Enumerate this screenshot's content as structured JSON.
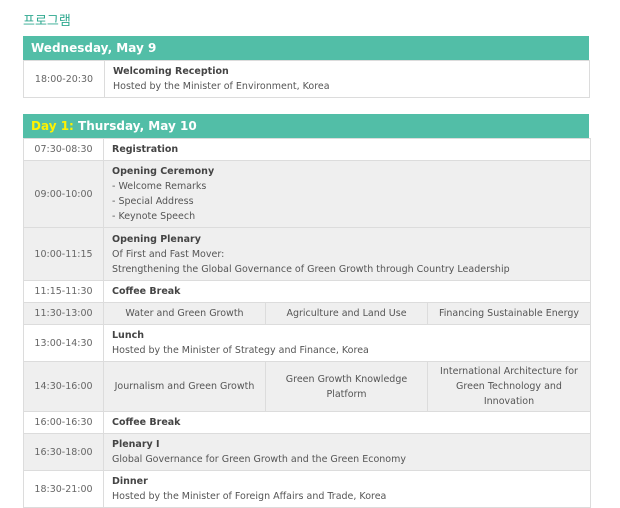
{
  "title": "프로그램",
  "pre_day": {
    "header": "Wednesday, May 9",
    "rows": [
      {
        "time": "18:00-20:30",
        "title": "Welcoming Reception",
        "lines": [
          "Hosted by the Minister of Environment, Korea"
        ]
      }
    ]
  },
  "day1": {
    "header_prefix": "Day 1:",
    "header_rest": " Thursday, May 10",
    "registration": {
      "time": "07:30-08:30",
      "title": "Registration"
    },
    "opening_ceremony": {
      "time": "09:00-10:00",
      "title": "Opening Ceremony",
      "lines": [
        "- Welcome Remarks",
        "- Special Address",
        "- Keynote Speech"
      ]
    },
    "opening_plenary": {
      "time": "10:00-11:15",
      "title": "Opening Plenary",
      "lines": [
        "Of First and Fast Mover:",
        "Strengthening the Global Governance of Green Growth through Country Leadership"
      ]
    },
    "coffee1": {
      "time": "11:15-11:30",
      "title": "Coffee Break"
    },
    "sessions1": {
      "time": "11:30-13:00",
      "tracks": [
        "Water and Green Growth",
        "Agriculture and Land Use",
        "Financing Sustainable Energy"
      ]
    },
    "lunch": {
      "time": "13:00-14:30",
      "title": "Lunch",
      "lines": [
        "Hosted by the Minister of Strategy and Finance, Korea"
      ]
    },
    "sessions2": {
      "time": "14:30-16:00",
      "tracks": [
        "Journalism and Green Growth",
        "Green Growth Knowledge Platform",
        "International Architecture for Green Technology and Innovation"
      ]
    },
    "coffee2": {
      "time": "16:00-16:30",
      "title": "Coffee Break"
    },
    "plenary1": {
      "time": "16:30-18:00",
      "title": "Plenary I",
      "lines": [
        "Global Governance for Green Growth and the Green Economy"
      ]
    },
    "dinner": {
      "time": "18:30-21:00",
      "title": "Dinner",
      "lines": [
        "Hosted by the Minister of Foreign Affairs and Trade, Korea"
      ]
    }
  },
  "colors": {
    "header_bg": "#52bea7",
    "highlight": "#fff200",
    "title": "#2ea88f"
  }
}
